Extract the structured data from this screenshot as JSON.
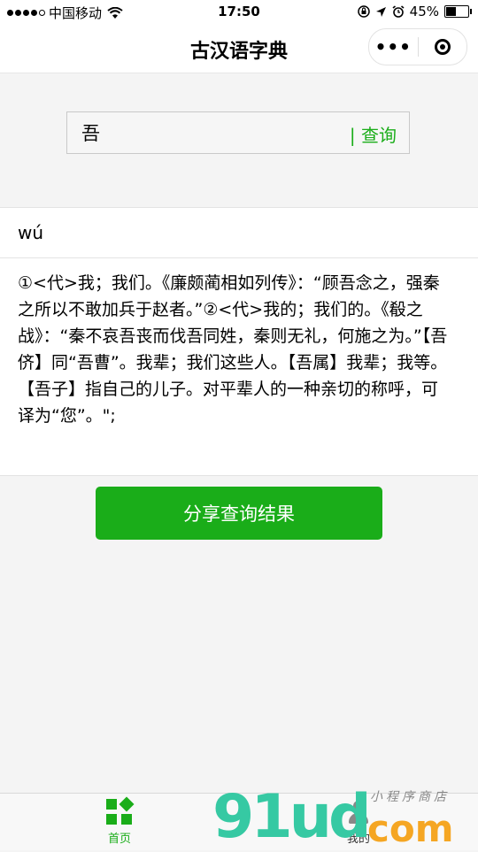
{
  "status_bar": {
    "carrier": "中国移动",
    "time": "17:50",
    "battery": "45%",
    "battery_level": 0.45
  },
  "nav": {
    "title": "古汉语字典",
    "more_label": "•••"
  },
  "search": {
    "value": "吾",
    "button_label": "| 查询"
  },
  "result": {
    "pinyin": "wú",
    "definition": "①<代>我；我们。《廉颇蔺相如列传》：“顾吾念之，强秦之所以不敢加兵于赵者。”②<代>我的；我们的。《殽之战》：“秦不哀吾丧而伐吾同姓，秦则无礼，何施之为。”【吾侪】同“吾曹”。我辈；我们这些人。【吾属】我辈；我等。【吾子】指自己的儿子。对平辈人的一种亲切的称呼，可译为“您”。\";"
  },
  "share_button": "分享查询结果",
  "tabbar": {
    "home": "首页",
    "mine": "我的"
  },
  "watermark": {
    "left": "91ud",
    "right": "com",
    "sub": "小程序商店"
  },
  "colors": {
    "accent": "#1aad19"
  }
}
